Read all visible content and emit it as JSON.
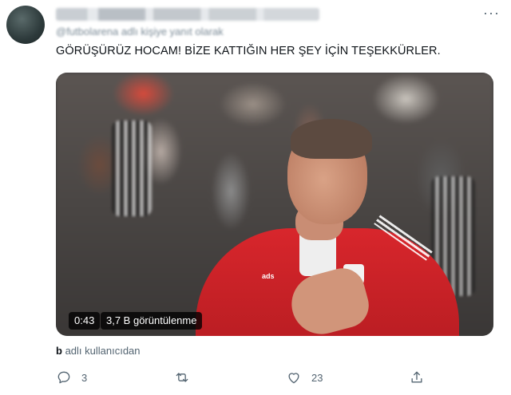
{
  "tweet": {
    "author_blurred": "",
    "reply_line_blurred": "@futbolarena adlı kişiye yanıt olarak",
    "text": "GÖRÜŞÜRÜZ HOCAM! BİZE KATTIĞIN HER ŞEY İÇİN TEŞEKKÜRLER.",
    "more_label": "···",
    "media": {
      "duration": "0:43",
      "views": "3,7 B görüntülenme",
      "kit_brand": "ads"
    },
    "attribution_user": "b",
    "attribution_suffix": " adlı kullanıcıdan",
    "actions": {
      "reply_count": "3",
      "retweet_count": "",
      "like_count": "23"
    }
  },
  "colors": {
    "text": "#0f1419",
    "muted": "#536471",
    "jersey": "#d8262c"
  }
}
